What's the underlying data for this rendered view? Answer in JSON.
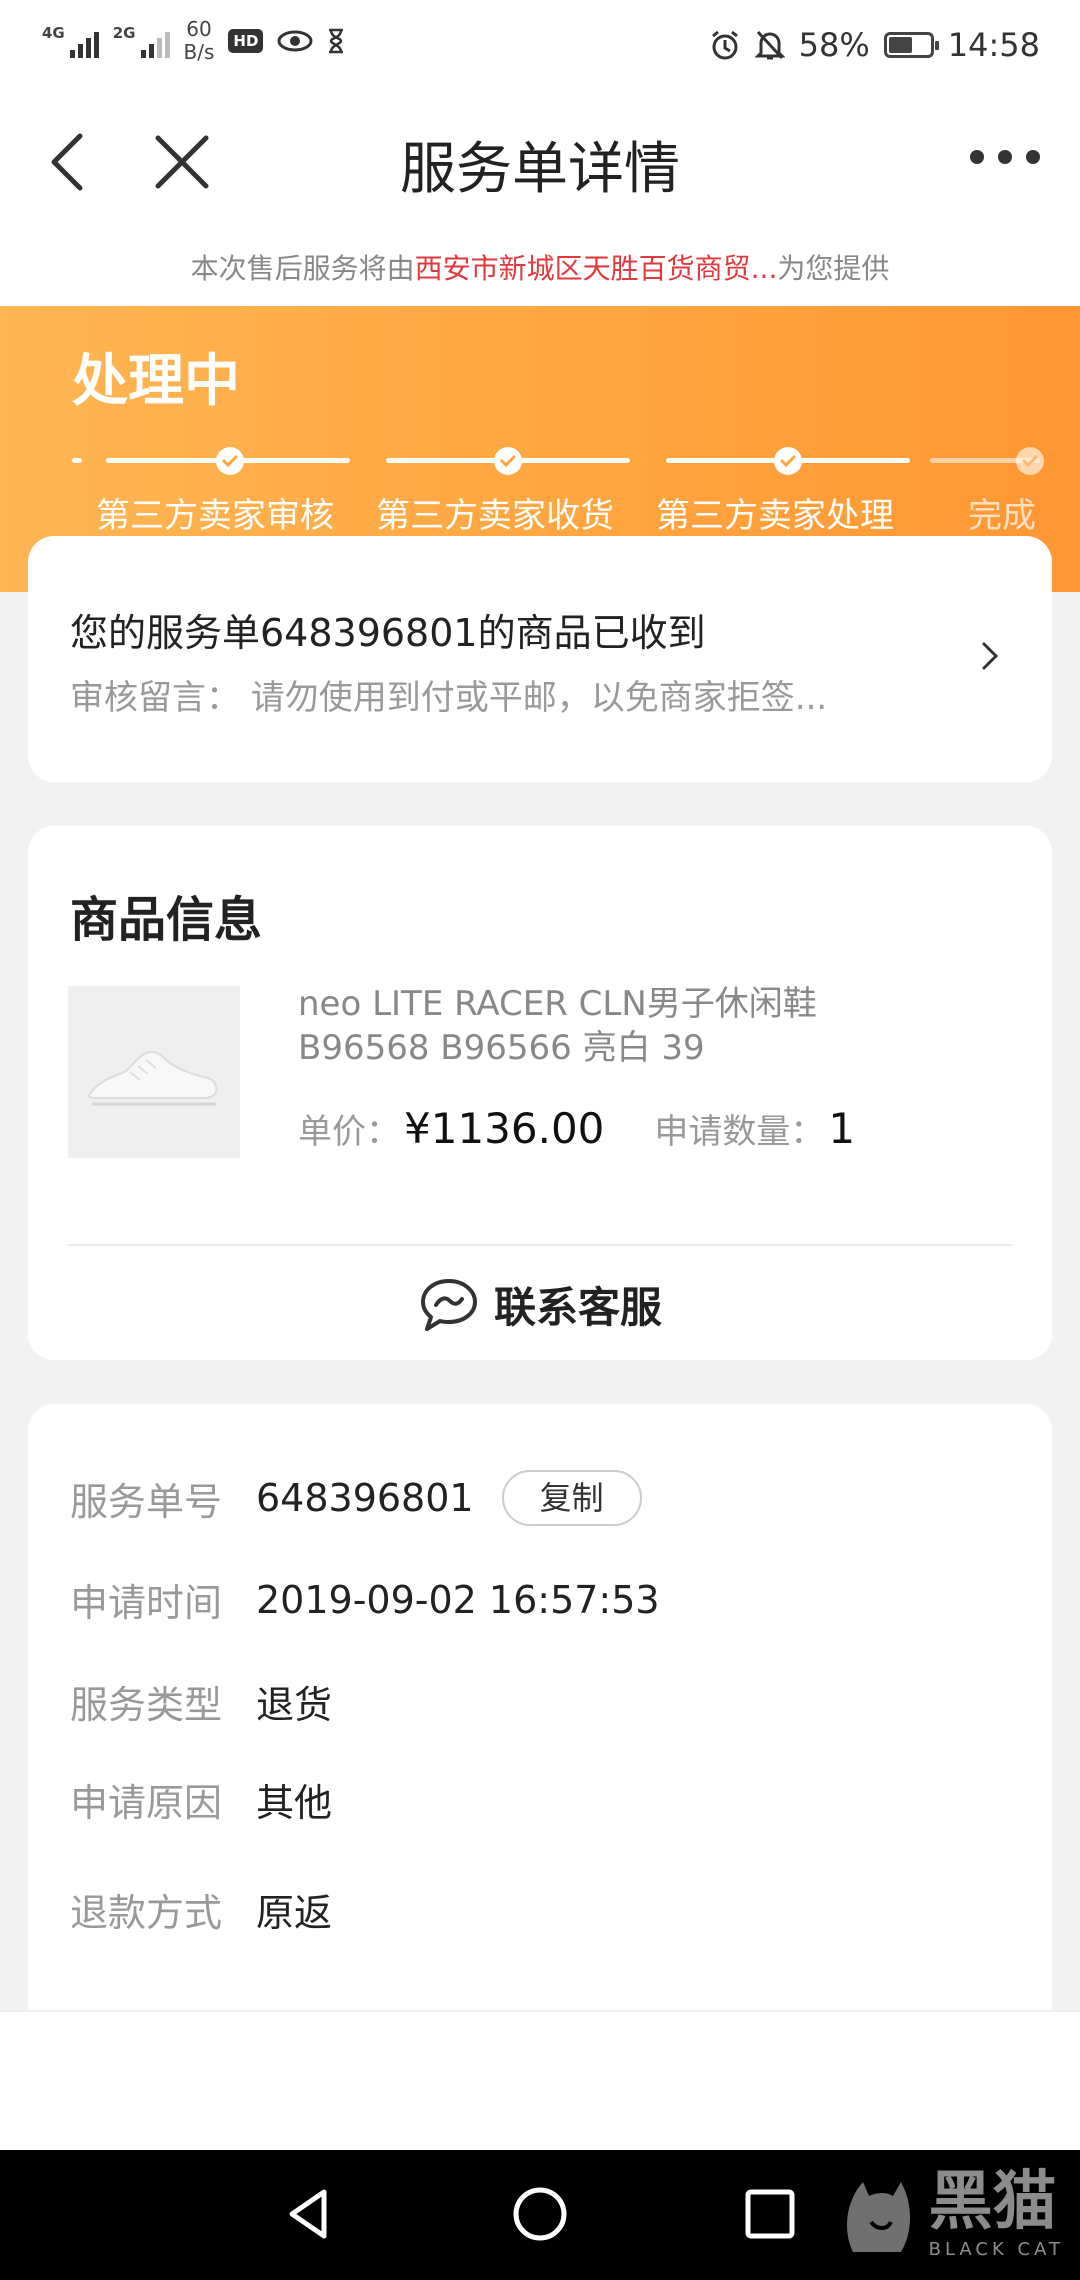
{
  "status_bar": {
    "network1": "4G",
    "network2": "2G",
    "speed_value": "60",
    "speed_unit": "B/s",
    "hd_badge": "HD",
    "battery_percent": "58%",
    "battery_level": 0.58,
    "time": "14:58"
  },
  "nav": {
    "title": "服务单详情"
  },
  "notice": {
    "prefix": "本次售后服务将由",
    "shop": "西安市新城区天胜百货商贸...",
    "suffix": "为您提供"
  },
  "progress": {
    "status_title": "处理中",
    "steps": [
      "第三方卖家审核",
      "第三方卖家收货",
      "第三方卖家处理",
      "完成"
    ]
  },
  "message_card": {
    "title": "您的服务单648396801的商品已收到",
    "subtitle": "审核留言： 请勿使用到付或平邮，以免商家拒签..."
  },
  "product": {
    "section_title": "商品信息",
    "name_line1": "neo LITE RACER CLN男子休闲鞋",
    "name_line2": "B96568 B96566 亮白 39",
    "price_label": "单价：",
    "price": "¥1136.00",
    "qty_label": "申请数量：",
    "qty": "1",
    "contact_label": "联系客服"
  },
  "details": {
    "order_no_label": "服务单号",
    "order_no": "648396801",
    "copy_label": "复制",
    "time_label": "申请时间",
    "time": "2019-09-02 16:57:53",
    "type_label": "服务类型",
    "type": "退货",
    "reason_label": "申请原因",
    "reason": "其他",
    "refund_label": "退款方式",
    "refund": "原返"
  },
  "watermark": {
    "cn": "黑猫",
    "en": "BLACK CAT"
  },
  "colors": {
    "accent_orange": "#ffa53f",
    "shop_red": "#e0393e"
  }
}
